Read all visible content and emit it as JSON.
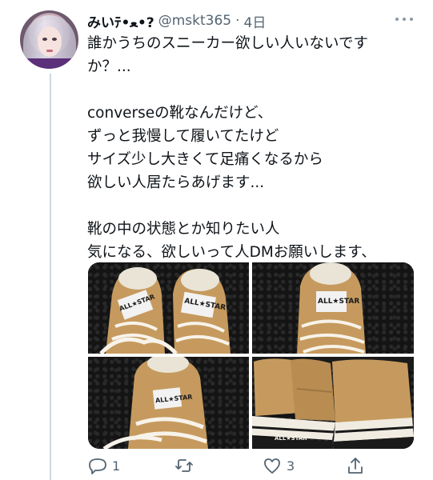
{
  "tweet": {
    "display_name": "みいﾃ•ﻌ•?",
    "handle": "@mskt365",
    "separator": "·",
    "time": "4日",
    "lines": [
      "誰かうちのスニーカー欲しい人いないです",
      "か？...",
      "",
      "converseの靴なんだけど、",
      "ずっと我慢して履いてたけど",
      "サイズ少し大きくて足痛くなるから",
      "欲しい人居たらあげます...",
      "",
      "靴の中の状態とか知りたい人",
      "気になる、欲しいって人DMお願いします、"
    ],
    "media": {
      "photos": [
        {
          "label_left": "ALL★STAR",
          "label_right": "ALL★STAR"
        },
        {
          "label": "ALL★STAR"
        },
        {
          "label": "ALL★STAR"
        },
        {
          "label": "ALL★STAR"
        }
      ]
    },
    "actions": {
      "reply_count": "1",
      "retweet_count": "",
      "like_count": "3"
    }
  },
  "colors": {
    "text": "#0f1419",
    "secondary": "#536471",
    "canvas_tan": "#c69a5e",
    "background_photo": "#141414"
  }
}
